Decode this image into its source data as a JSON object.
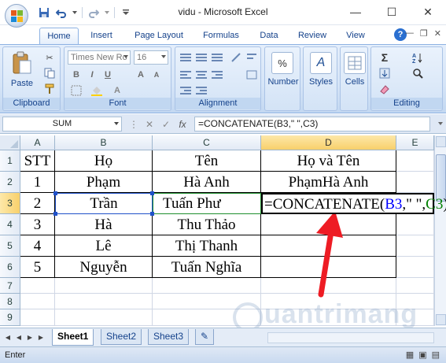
{
  "window": {
    "title": "vidu - Microsoft Excel"
  },
  "tabs": [
    {
      "label": "Home",
      "active": true
    },
    {
      "label": "Insert"
    },
    {
      "label": "Page Layout"
    },
    {
      "label": "Formulas"
    },
    {
      "label": "Data"
    },
    {
      "label": "Review"
    },
    {
      "label": "View"
    }
  ],
  "ribbon": {
    "clipboard": {
      "group_label": "Clipboard",
      "paste_label": "Paste"
    },
    "font": {
      "group_label": "Font",
      "font_name": "Times New Ro",
      "font_size": "16",
      "bold": "B",
      "italic": "I",
      "underline": "U",
      "grow": "A",
      "shrink": "A"
    },
    "alignment": {
      "group_label": "Alignment"
    },
    "number": {
      "label": "Number",
      "icon": "%"
    },
    "styles": {
      "label": "Styles",
      "icon": "A"
    },
    "cells": {
      "label": "Cells"
    },
    "editing": {
      "group_label": "Editing",
      "sum_glyph": "Σ"
    }
  },
  "formula_bar": {
    "name_box": "SUM",
    "fx": "fx",
    "formula": "=CONCATENATE(B3,\" \",C3)"
  },
  "sheet": {
    "columns": [
      "A",
      "B",
      "C",
      "D",
      "E"
    ],
    "rows": [
      "1",
      "2",
      "3",
      "4",
      "5",
      "6",
      "7",
      "8",
      "9"
    ],
    "cells": {
      "A1": "STT",
      "B1": "Họ",
      "C1": "Tên",
      "D1": "Họ và Tên",
      "A2": "1",
      "B2": "Phạm",
      "C2": "Hà Anh",
      "D2": "PhạmHà Anh",
      "A3": "2",
      "B3": "Trần",
      "C3": "Tuấn Phư",
      "D3_prefix": "=CONCATENATE(",
      "D3_ref1": "B3",
      "D3_mid": ",\" \",",
      "D3_ref2": "C3",
      "D3_suffix": ")",
      "A4": "3",
      "B4": "Hà",
      "C4": "Thu Thảo",
      "A5": "4",
      "B5": "Lê",
      "C5": "Thị Thanh",
      "A6": "5",
      "B6": "Nguyễn",
      "C6": "Tuấn Nghĩa"
    },
    "ref_colors": {
      "ref1": "#0000ff",
      "ref2": "#008000"
    }
  },
  "sheet_tabs": [
    {
      "label": "Sheet1",
      "active": true
    },
    {
      "label": "Sheet2"
    },
    {
      "label": "Sheet3"
    }
  ],
  "status": {
    "mode": "Enter"
  },
  "watermark": "uantrimang"
}
